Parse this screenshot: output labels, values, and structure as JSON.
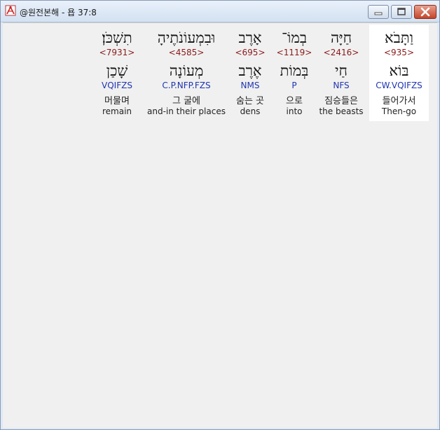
{
  "window": {
    "title": "@원전본해 - 욥 37:8"
  },
  "icons": {
    "app": "compass-pen-icon",
    "minimize": "minimize-icon",
    "maximize": "maximize-icon",
    "close": "close-icon"
  },
  "words": [
    {
      "hebrew": "וַתָּבֹא",
      "strong": "<935>",
      "lemma": "בּוֹא",
      "morph": "CW.VQIFZS",
      "korean": "들어가서",
      "english": "Then-go"
    },
    {
      "hebrew": "חַיָּה",
      "strong": "<2416>",
      "lemma": "חַי",
      "morph": "NFS",
      "korean": "짐승들은",
      "english": "the beasts"
    },
    {
      "hebrew": "בְמוֹ־",
      "strong": "<1119>",
      "lemma": "בְּמוֹת",
      "morph": "P",
      "korean": "으로",
      "english": "into"
    },
    {
      "hebrew": "אָרֶב",
      "strong": "<695>",
      "lemma": "אֶרֶב",
      "morph": "NMS",
      "korean": "숨는 곳",
      "english": "dens"
    },
    {
      "hebrew": "וּבִמְעוֹנֹתֶיהָ",
      "strong": "<4585>",
      "lemma": "מְעוֹנָה",
      "morph": "C.P.NFP.FZS",
      "korean": "그 굴에",
      "english": "and-in their places"
    },
    {
      "hebrew": "תִשְׁכֹּן׃",
      "strong": "<7931>",
      "lemma": "שָׁכַן",
      "morph": "VQIFZS",
      "korean": "머물며",
      "english": "remain"
    }
  ]
}
